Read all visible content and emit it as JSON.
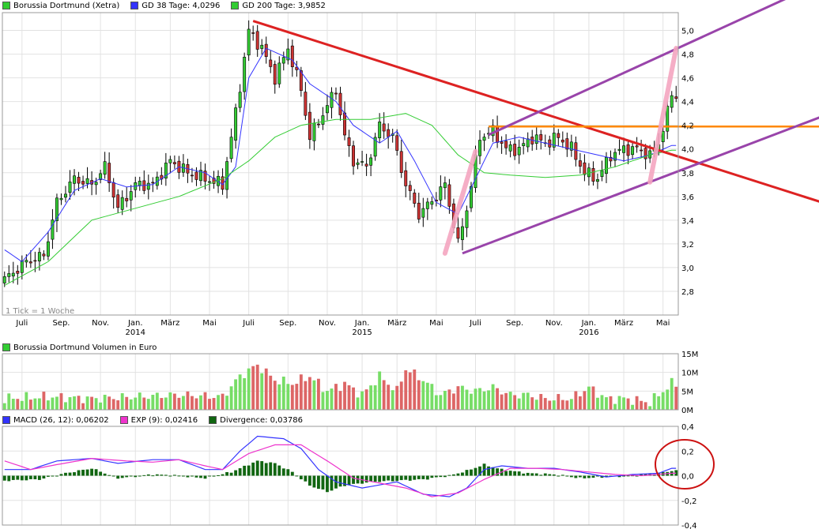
{
  "chart_data": [
    {
      "type": "candlestick",
      "legend": [
        {
          "label": "Borussia Dortmund (Xetra)",
          "color": "#33cc33"
        },
        {
          "label": "GD 38 Tage: 4,0296",
          "color": "#3333ff"
        },
        {
          "label": "GD 200 Tage: 3,9852",
          "color": "#33cc33"
        }
      ],
      "note": "1 Tick = 1 Woche",
      "ylim": [
        2.6,
        5.15
      ],
      "yticks": [
        {
          "v": 2.8,
          "label": "2,8"
        },
        {
          "v": 3.0,
          "label": "3,0"
        },
        {
          "v": 3.2,
          "label": "3,2"
        },
        {
          "v": 3.4,
          "label": "3,4"
        },
        {
          "v": 3.6,
          "label": "3,6"
        },
        {
          "v": 3.8,
          "label": "3,8"
        },
        {
          "v": 4.0,
          "label": "4,0"
        },
        {
          "v": 4.2,
          "label": "4,2"
        },
        {
          "v": 4.4,
          "label": "4,4"
        },
        {
          "v": 4.6,
          "label": "4,6"
        },
        {
          "v": 4.8,
          "label": "4,8"
        },
        {
          "v": 5.0,
          "label": "5,0"
        }
      ],
      "month_labels": [
        "Juli",
        "Sep.",
        "Nov.",
        "Jan.",
        "März",
        "Mai",
        "Juli",
        "Sep.",
        "Nov.",
        "Jan.",
        "März",
        "Mai",
        "Juli",
        "Sep.",
        "Nov.",
        "Jan.",
        "März",
        "Mai"
      ],
      "month_weeks": [
        4,
        13,
        22,
        30,
        38,
        47,
        56,
        65,
        74,
        82,
        90,
        99,
        108,
        117,
        126,
        134,
        142,
        151
      ],
      "year_labels": [
        {
          "label": "2014",
          "week": 30
        },
        {
          "label": "2015",
          "week": 82
        },
        {
          "label": "2016",
          "week": 134
        }
      ],
      "weeks": 155,
      "close_keypoints": [
        [
          0,
          2.9
        ],
        [
          5,
          3.05
        ],
        [
          9,
          3.1
        ],
        [
          12,
          3.55
        ],
        [
          16,
          3.75
        ],
        [
          20,
          3.7
        ],
        [
          23,
          3.85
        ],
        [
          26,
          3.5
        ],
        [
          30,
          3.7
        ],
        [
          34,
          3.7
        ],
        [
          38,
          3.9
        ],
        [
          42,
          3.8
        ],
        [
          46,
          3.75
        ],
        [
          50,
          3.7
        ],
        [
          53,
          4.3
        ],
        [
          56,
          5.0
        ],
        [
          59,
          4.85
        ],
        [
          62,
          4.6
        ],
        [
          65,
          4.85
        ],
        [
          68,
          4.5
        ],
        [
          70,
          4.1
        ],
        [
          73,
          4.3
        ],
        [
          76,
          4.5
        ],
        [
          78,
          4.1
        ],
        [
          80,
          3.9
        ],
        [
          83,
          3.85
        ],
        [
          86,
          4.2
        ],
        [
          89,
          4.1
        ],
        [
          92,
          3.7
        ],
        [
          95,
          3.45
        ],
        [
          99,
          3.6
        ],
        [
          101,
          3.7
        ],
        [
          104,
          3.2
        ],
        [
          106,
          3.5
        ],
        [
          109,
          4.1
        ],
        [
          112,
          4.15
        ],
        [
          115,
          4.0
        ],
        [
          118,
          4.0
        ],
        [
          121,
          4.1
        ],
        [
          124,
          4.05
        ],
        [
          127,
          4.1
        ],
        [
          130,
          4.0
        ],
        [
          133,
          3.8
        ],
        [
          136,
          3.75
        ],
        [
          139,
          3.95
        ],
        [
          142,
          4.0
        ],
        [
          145,
          4.0
        ],
        [
          148,
          3.95
        ],
        [
          150,
          4.05
        ],
        [
          153,
          4.45
        ]
      ],
      "series": [
        {
          "name": "GD 38 Tage",
          "color": "#3333ff",
          "keypoints": [
            [
              0,
              3.15
            ],
            [
              4,
              3.05
            ],
            [
              10,
              3.3
            ],
            [
              16,
              3.65
            ],
            [
              22,
              3.75
            ],
            [
              28,
              3.68
            ],
            [
              34,
              3.7
            ],
            [
              40,
              3.85
            ],
            [
              46,
              3.8
            ],
            [
              50,
              3.7
            ],
            [
              53,
              3.85
            ],
            [
              56,
              4.6
            ],
            [
              60,
              4.85
            ],
            [
              66,
              4.75
            ],
            [
              70,
              4.55
            ],
            [
              76,
              4.4
            ],
            [
              80,
              4.2
            ],
            [
              86,
              4.05
            ],
            [
              90,
              4.15
            ],
            [
              94,
              3.9
            ],
            [
              99,
              3.55
            ],
            [
              104,
              3.45
            ],
            [
              108,
              3.75
            ],
            [
              112,
              4.05
            ],
            [
              118,
              4.1
            ],
            [
              124,
              4.05
            ],
            [
              130,
              4.0
            ],
            [
              136,
              3.95
            ],
            [
              142,
              3.9
            ],
            [
              148,
              3.95
            ],
            [
              153,
              4.03
            ]
          ]
        },
        {
          "name": "GD 200 Tage",
          "color": "#33cc33",
          "keypoints": [
            [
              0,
              2.85
            ],
            [
              10,
              3.05
            ],
            [
              20,
              3.4
            ],
            [
              30,
              3.5
            ],
            [
              40,
              3.6
            ],
            [
              50,
              3.75
            ],
            [
              56,
              3.9
            ],
            [
              62,
              4.1
            ],
            [
              68,
              4.2
            ],
            [
              76,
              4.25
            ],
            [
              84,
              4.25
            ],
            [
              92,
              4.3
            ],
            [
              98,
              4.2
            ],
            [
              104,
              3.95
            ],
            [
              110,
              3.8
            ],
            [
              116,
              3.78
            ],
            [
              124,
              3.76
            ],
            [
              132,
              3.78
            ],
            [
              140,
              3.85
            ],
            [
              148,
              3.95
            ],
            [
              153,
              3.99
            ]
          ]
        }
      ],
      "overlays": [
        {
          "name": "downtrend",
          "color": "#dd2222",
          "from": [
            57,
            5.08
          ],
          "to": [
            190,
            3.52
          ]
        },
        {
          "name": "resistance",
          "color": "#ff8800",
          "from": [
            111,
            4.19
          ],
          "to": [
            190,
            4.19
          ]
        },
        {
          "name": "channel-upper",
          "color": "#9944aa",
          "from": [
            111,
            4.12
          ],
          "to": [
            190,
            5.45
          ]
        },
        {
          "name": "channel-lower",
          "color": "#9944aa",
          "from": [
            105,
            3.12
          ],
          "to": [
            190,
            4.31
          ]
        },
        {
          "name": "marker-1",
          "color": "#f4a6c0",
          "from": [
            101,
            3.12
          ],
          "to": [
            108,
            3.98
          ]
        },
        {
          "name": "marker-2",
          "color": "#f4a6c0",
          "from": [
            148,
            3.72
          ],
          "to": [
            154,
            4.85
          ]
        }
      ]
    },
    {
      "type": "bar",
      "title": "Borussia Dortmund Volumen in Euro",
      "ylim": [
        0,
        15
      ],
      "yticks": [
        {
          "v": 0,
          "label": "0M"
        },
        {
          "v": 5,
          "label": "5M"
        },
        {
          "v": 10,
          "label": "10M"
        },
        {
          "v": 15,
          "label": "15M"
        }
      ],
      "unit": "M",
      "values_keypoints": [
        [
          0,
          3
        ],
        [
          10,
          3.5
        ],
        [
          20,
          3
        ],
        [
          30,
          3.5
        ],
        [
          40,
          4
        ],
        [
          50,
          3.5
        ],
        [
          54,
          9
        ],
        [
          58,
          12
        ],
        [
          62,
          8
        ],
        [
          66,
          7
        ],
        [
          70,
          9
        ],
        [
          74,
          5
        ],
        [
          78,
          7
        ],
        [
          82,
          4
        ],
        [
          86,
          9
        ],
        [
          90,
          5
        ],
        [
          92,
          11
        ],
        [
          96,
          8
        ],
        [
          100,
          4
        ],
        [
          104,
          6
        ],
        [
          108,
          5
        ],
        [
          112,
          6
        ],
        [
          116,
          4
        ],
        [
          120,
          4
        ],
        [
          124,
          3
        ],
        [
          130,
          3
        ],
        [
          134,
          6
        ],
        [
          138,
          3
        ],
        [
          142,
          3
        ],
        [
          148,
          2
        ],
        [
          153,
          7
        ]
      ]
    },
    {
      "type": "line",
      "legend": [
        {
          "label": "MACD (26, 12): 0,06202",
          "color": "#3333ff"
        },
        {
          "label": "EXP (9): 0,02416",
          "color": "#ee33cc"
        },
        {
          "label": "Divergence: 0,03786",
          "color": "#116611"
        }
      ],
      "ylim": [
        -0.4,
        0.4
      ],
      "yticks": [
        {
          "v": 0.4,
          "label": "0,4"
        },
        {
          "v": 0.2,
          "label": "0,2"
        },
        {
          "v": 0.0,
          "label": "0,0"
        },
        {
          "v": -0.2,
          "label": "-0,2"
        },
        {
          "v": -0.4,
          "label": "-0,4"
        }
      ],
      "series": [
        {
          "name": "MACD",
          "color": "#3333ff",
          "keypoints": [
            [
              0,
              0.05
            ],
            [
              6,
              0.05
            ],
            [
              12,
              0.12
            ],
            [
              20,
              0.14
            ],
            [
              26,
              0.1
            ],
            [
              34,
              0.13
            ],
            [
              40,
              0.13
            ],
            [
              46,
              0.05
            ],
            [
              50,
              0.05
            ],
            [
              54,
              0.2
            ],
            [
              58,
              0.32
            ],
            [
              64,
              0.3
            ],
            [
              68,
              0.22
            ],
            [
              72,
              0.05
            ],
            [
              76,
              -0.05
            ],
            [
              82,
              -0.1
            ],
            [
              90,
              -0.05
            ],
            [
              96,
              -0.15
            ],
            [
              102,
              -0.17
            ],
            [
              106,
              -0.1
            ],
            [
              110,
              0.05
            ],
            [
              114,
              0.08
            ],
            [
              120,
              0.06
            ],
            [
              126,
              0.06
            ],
            [
              132,
              0.03
            ],
            [
              138,
              -0.01
            ],
            [
              144,
              0.01
            ],
            [
              150,
              0.02
            ],
            [
              153,
              0.06
            ]
          ]
        },
        {
          "name": "EXP",
          "color": "#ee33cc",
          "keypoints": [
            [
              0,
              0.12
            ],
            [
              6,
              0.05
            ],
            [
              12,
              0.09
            ],
            [
              20,
              0.14
            ],
            [
              28,
              0.12
            ],
            [
              34,
              0.11
            ],
            [
              40,
              0.13
            ],
            [
              46,
              0.08
            ],
            [
              50,
              0.05
            ],
            [
              56,
              0.18
            ],
            [
              62,
              0.25
            ],
            [
              68,
              0.25
            ],
            [
              74,
              0.12
            ],
            [
              80,
              -0.02
            ],
            [
              86,
              -0.06
            ],
            [
              92,
              -0.1
            ],
            [
              98,
              -0.17
            ],
            [
              104,
              -0.14
            ],
            [
              110,
              -0.03
            ],
            [
              116,
              0.06
            ],
            [
              122,
              0.06
            ],
            [
              128,
              0.05
            ],
            [
              134,
              0.03
            ],
            [
              140,
              0.01
            ],
            [
              146,
              0.0
            ],
            [
              153,
              0.02
            ]
          ]
        }
      ],
      "divergence_keypoints": [
        [
          0,
          -0.04
        ],
        [
          8,
          -0.03
        ],
        [
          14,
          0.02
        ],
        [
          20,
          0.06
        ],
        [
          26,
          -0.02
        ],
        [
          34,
          0.01
        ],
        [
          40,
          0.0
        ],
        [
          46,
          -0.02
        ],
        [
          52,
          0.03
        ],
        [
          58,
          0.12
        ],
        [
          62,
          0.1
        ],
        [
          66,
          0.03
        ],
        [
          70,
          -0.08
        ],
        [
          74,
          -0.13
        ],
        [
          78,
          -0.08
        ],
        [
          84,
          -0.05
        ],
        [
          90,
          -0.04
        ],
        [
          96,
          -0.03
        ],
        [
          102,
          0.0
        ],
        [
          106,
          0.04
        ],
        [
          110,
          0.09
        ],
        [
          114,
          0.05
        ],
        [
          120,
          0.02
        ],
        [
          126,
          0.01
        ],
        [
          132,
          -0.02
        ],
        [
          138,
          -0.01
        ],
        [
          144,
          0.0
        ],
        [
          150,
          0.02
        ],
        [
          153,
          0.04
        ]
      ]
    }
  ]
}
